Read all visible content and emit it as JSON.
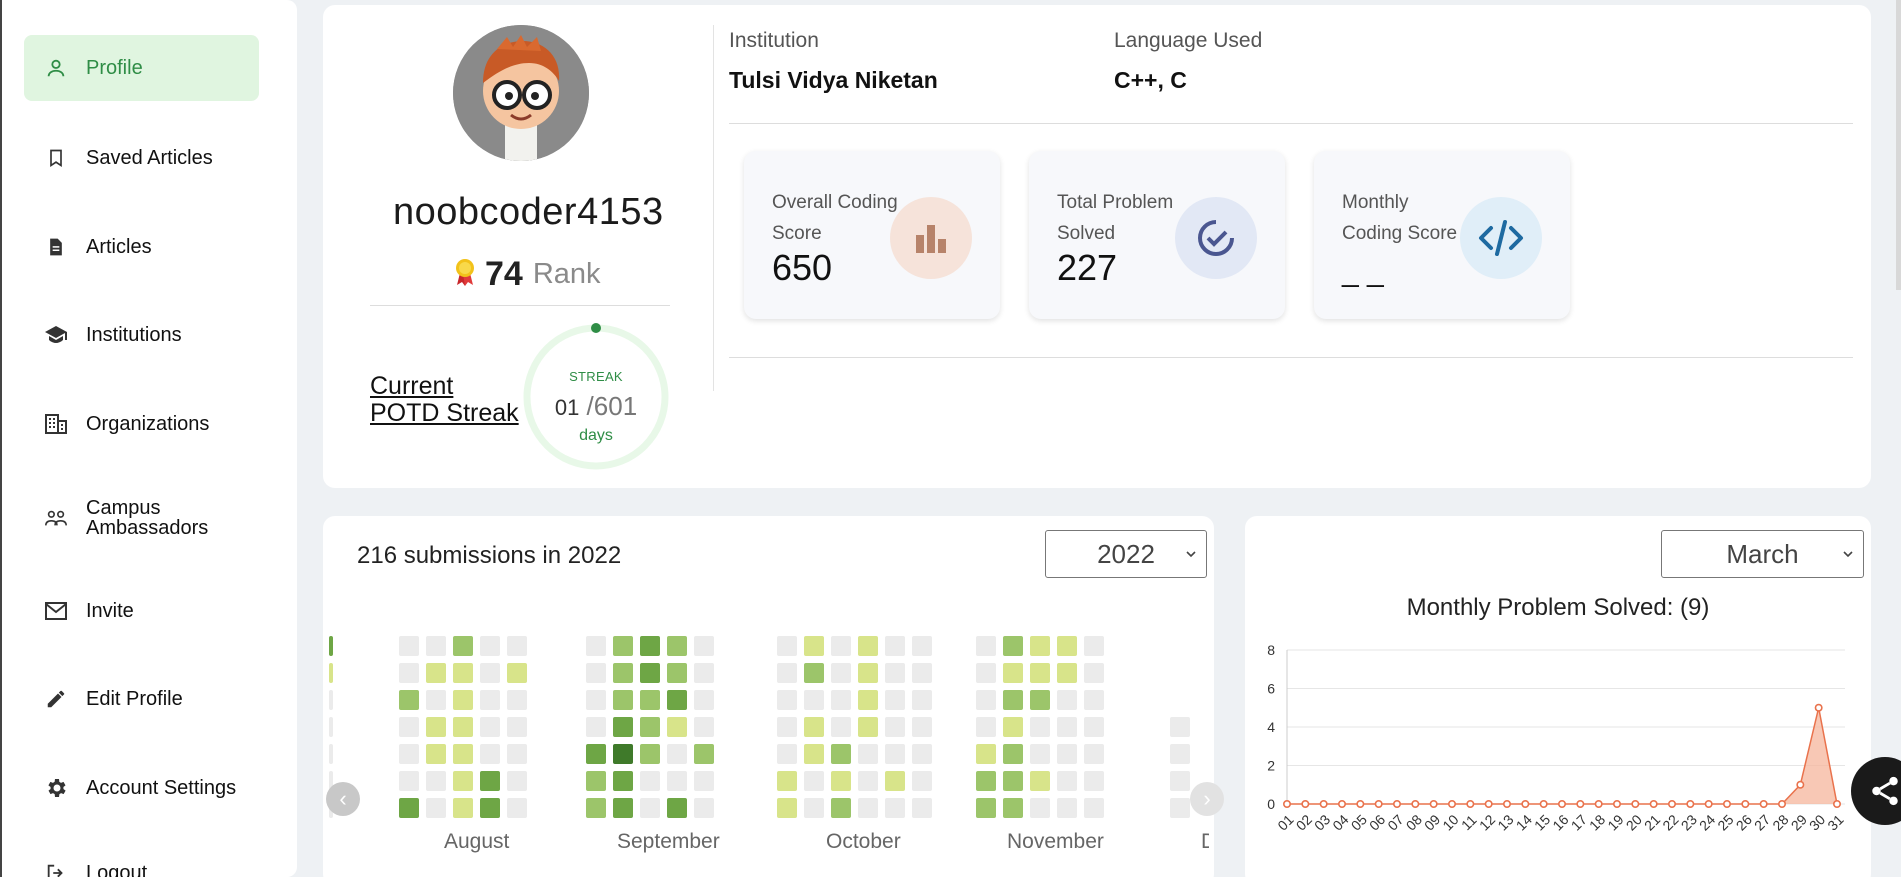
{
  "sidebar": {
    "items": [
      {
        "label": "Profile",
        "icon": "person-icon",
        "active": true
      },
      {
        "label": "Saved Articles",
        "icon": "bookmark-icon"
      },
      {
        "label": "Articles",
        "icon": "document-icon"
      },
      {
        "label": "Institutions",
        "icon": "graduation-cap-icon"
      },
      {
        "label": "Organizations",
        "icon": "building-icon"
      },
      {
        "label": "Campus Ambassadors",
        "icon": "people-icon"
      },
      {
        "label": "Invite",
        "icon": "mail-icon"
      },
      {
        "label": "Edit Profile",
        "icon": "pencil-icon"
      },
      {
        "label": "Account Settings",
        "icon": "gear-icon"
      },
      {
        "label": "Logout",
        "icon": "logout-icon"
      }
    ]
  },
  "profile": {
    "username": "noobcoder4153",
    "rank": "74",
    "rank_label": "Rank",
    "streak_label": "Current POTD Streak",
    "streak_title": "STREAK",
    "streak_current": "01",
    "streak_total": "/601",
    "streak_unit": "days"
  },
  "info": {
    "institution_label": "Institution",
    "institution_value": "Tulsi Vidya Niketan",
    "language_label": "Language Used",
    "language_value": "C++, C"
  },
  "stats": [
    {
      "label": "Overall Coding Score",
      "value": "650",
      "icon": "bar-chart-icon"
    },
    {
      "label": "Total Problem Solved",
      "value": "227",
      "icon": "check-circle-icon"
    },
    {
      "label": "Monthly Coding Score",
      "value": "_ _",
      "icon": "code-icon"
    }
  ],
  "submissions": {
    "title": "216 submissions in 2022",
    "year_selected": "2022",
    "months": [
      "August",
      "September",
      "October",
      "November",
      "D"
    ]
  },
  "monthly_chart": {
    "month_selected": "March",
    "title": "Monthly Problem Solved: (9)"
  },
  "colors": {
    "accent": "#2f8d46",
    "active_bg": "#e0f5e0",
    "chart_line": "#e9724c",
    "chart_fill": "#f6b59c"
  },
  "chart_data": {
    "type": "area",
    "title": "Monthly Problem Solved: (9)",
    "xlabel": "",
    "ylabel": "",
    "x": [
      "01",
      "02",
      "03",
      "04",
      "05",
      "06",
      "07",
      "08",
      "09",
      "10",
      "11",
      "12",
      "13",
      "14",
      "15",
      "16",
      "17",
      "18",
      "19",
      "20",
      "21",
      "22",
      "23",
      "24",
      "25",
      "26",
      "27",
      "28",
      "29",
      "30",
      "31"
    ],
    "values": [
      0,
      0,
      0,
      0,
      0,
      0,
      0,
      0,
      0,
      0,
      0,
      0,
      0,
      0,
      0,
      0,
      0,
      0,
      0,
      0,
      0,
      0,
      0,
      0,
      0,
      0,
      0,
      0,
      1,
      5,
      0
    ],
    "ylim": [
      0,
      8
    ],
    "yticks": [
      0,
      2,
      4,
      6,
      8
    ],
    "grid": true
  }
}
